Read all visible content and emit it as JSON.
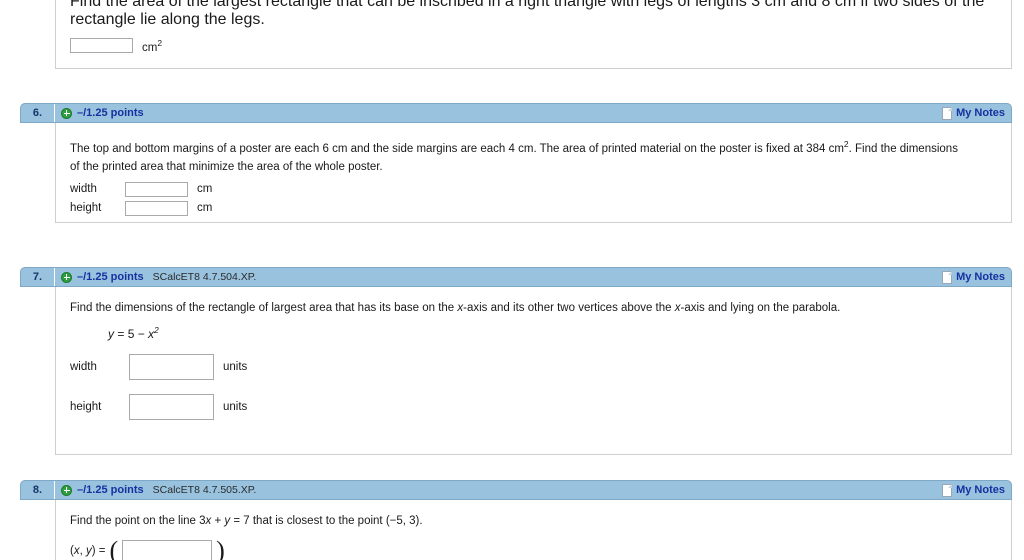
{
  "theme": {
    "header_bg": "#99c2de",
    "header_border": "#7fa8c6",
    "link_blue": "#1433a0",
    "plus_green": "#2f9e41",
    "panel_border": "#cfcfcf",
    "input_border": "#a9a9a9",
    "text": "#1a1a1a"
  },
  "questions": [
    {
      "id": "q5-tail",
      "number": "",
      "points": "",
      "code": "",
      "notes_label": "",
      "prompt": "Find the area of the largest rectangle that can be inscribed in a right triangle with legs of lengths 3 cm and 8 cm if two sides of the rectangle lie along the legs.",
      "answers": [
        {
          "label": "",
          "value": "",
          "placeholder": "",
          "unit": "cm",
          "unit_sup": "2"
        }
      ]
    },
    {
      "id": "q6",
      "number": "6.",
      "points": "–/1.25 points",
      "code": "",
      "notes_label": "My Notes",
      "prompt_a": "The top and bottom margins of a poster are each 6 cm and the side margins are each 4 cm. The area of printed material on the poster is fixed at 384 cm",
      "prompt_a_sup": "2",
      "prompt_b": ". Find the dimensions",
      "prompt_c": "of the printed area that minimize the area of the whole poster.",
      "answers": [
        {
          "label": "width",
          "value": "",
          "placeholder": "",
          "unit": "cm"
        },
        {
          "label": "height",
          "value": "",
          "placeholder": "",
          "unit": "cm"
        }
      ]
    },
    {
      "id": "q7",
      "number": "7.",
      "points": "–/1.25 points",
      "code": "SCalcET8 4.7.504.XP.",
      "notes_label": "My Notes",
      "prompt_1": "Find the dimensions of the rectangle of largest area that has its base on the ",
      "prompt_x1": "x",
      "prompt_2": "-axis and its other two vertices above the ",
      "prompt_x2": "x",
      "prompt_3": "-axis and lying on the parabola.",
      "equation": {
        "lhs": "y",
        "eq": " = ",
        "rhs_a": "5 ",
        "minus": "− ",
        "rhs_b": "x",
        "rhs_sup": "2"
      },
      "answers": [
        {
          "label": "width",
          "value": "",
          "placeholder": "",
          "unit": "units"
        },
        {
          "label": "height",
          "value": "",
          "placeholder": "",
          "unit": "units"
        }
      ]
    },
    {
      "id": "q8",
      "number": "8.",
      "points": "–/1.25 points",
      "code": "SCalcET8 4.7.505.XP.",
      "notes_label": "My Notes",
      "prompt_1": "Find the point on the line 3",
      "prompt_x": "x",
      "prompt_2": " + ",
      "prompt_y": "y",
      "prompt_3": " = 7 that is closest to the point  (−5, 3).",
      "coord_label_open": "(",
      "coord_x": "x",
      "coord_comma": ", ",
      "coord_y": "y",
      "coord_label_close": ") = ",
      "paren_open": "(",
      "paren_close": ")",
      "answers": [
        {
          "label": "",
          "value": "",
          "placeholder": "",
          "unit": ""
        }
      ]
    }
  ]
}
